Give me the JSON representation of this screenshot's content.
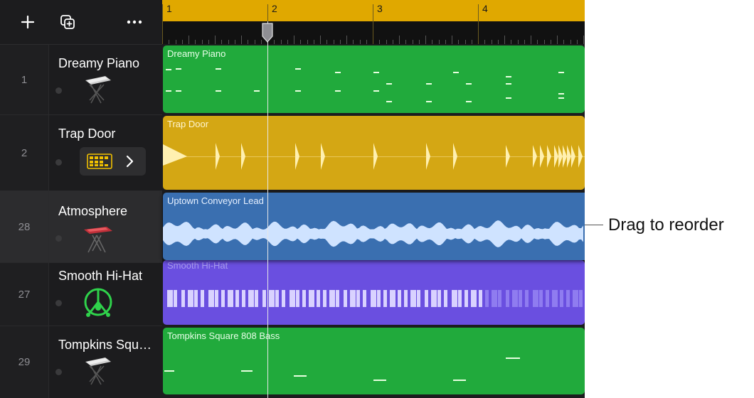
{
  "toolbar": {
    "add_icon": "plus-icon",
    "duplicate_icon": "duplicate-icon",
    "more_icon": "ellipsis-icon"
  },
  "ruler": {
    "bars": [
      "1",
      "2",
      "3",
      "4"
    ]
  },
  "tracks": [
    {
      "number": "1",
      "name": "Dreamy Piano",
      "instrument_icon": "keyboard-stand-icon",
      "region": "Dreamy Piano",
      "color": "#21aa3c"
    },
    {
      "number": "2",
      "name": "Trap Door",
      "instrument_icon": "beat-sequencer-icon",
      "region": "Trap Door",
      "color": "#d4a714"
    },
    {
      "number": "28",
      "name": "Atmosphere",
      "instrument_icon": "synth-stand-icon",
      "region": "Uptown Conveyor Lead",
      "color": "#3a6fb0"
    },
    {
      "number": "27",
      "name": "Smooth Hi-Hat",
      "instrument_icon": "drummer-icon",
      "region": "Smooth Hi-Hat",
      "color": "#6a4fe0"
    },
    {
      "number": "29",
      "name": "Tompkins Squ…",
      "instrument_icon": "keyboard-stand-icon",
      "region": "Tompkins Square 808 Bass",
      "color": "#21aa3c"
    }
  ],
  "callout": {
    "text": "Drag to reorder"
  }
}
